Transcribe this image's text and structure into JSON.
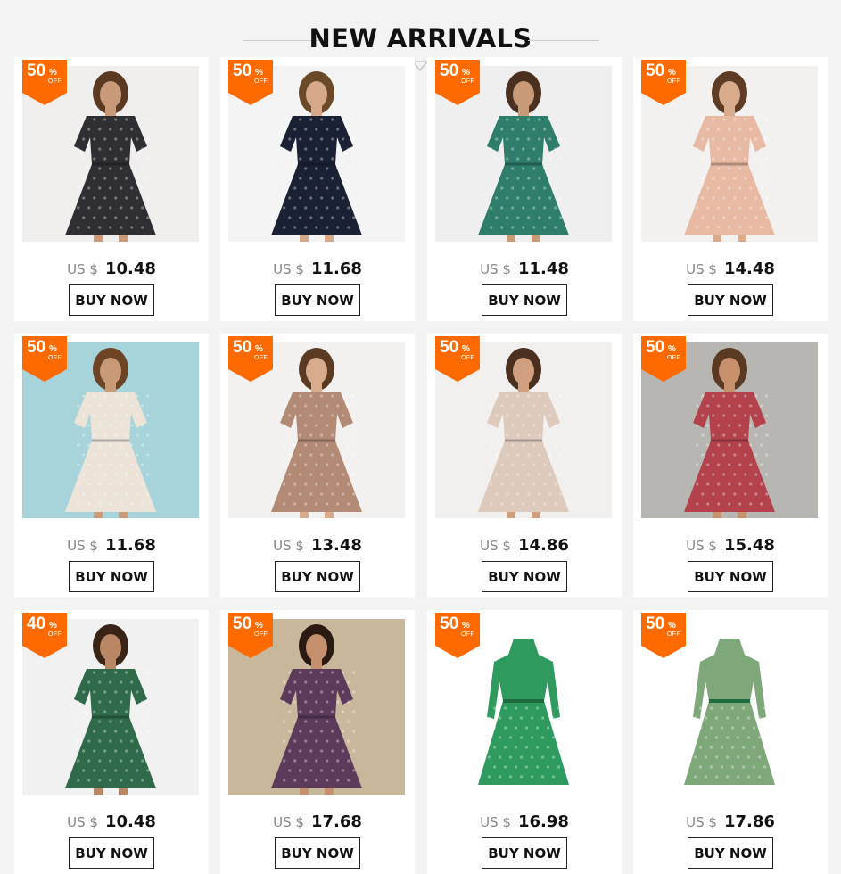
{
  "header": {
    "title": "NEW ARRIVALS",
    "arrow_icon": "chevron-down-icon"
  },
  "badge": {
    "percent_sign": "%",
    "off_label": "OFF",
    "color": "#ff6a00"
  },
  "products": [
    {
      "discount": "50",
      "currency": "US $",
      "price": "10.48",
      "button": "BUY NOW",
      "dress": "#2f2f33",
      "skin": "#c89a7a",
      "bg": "#f1efee",
      "hair": "#5a3a22"
    },
    {
      "discount": "50",
      "currency": "US $",
      "price": "11.68",
      "button": "BUY NOW",
      "dress": "#1b2134",
      "skin": "#d5a98a",
      "bg": "#f4f4f4",
      "hair": "#6b4a2a"
    },
    {
      "discount": "50",
      "currency": "US $",
      "price": "11.48",
      "button": "BUY NOW",
      "dress": "#2f7d6b",
      "skin": "#c99a78",
      "bg": "#efefef",
      "hair": "#4a3020"
    },
    {
      "discount": "50",
      "currency": "US $",
      "price": "14.48",
      "button": "BUY NOW",
      "dress": "#e8b9a3",
      "skin": "#d8ab8c",
      "bg": "#f2f1ef",
      "hair": "#5d3b25"
    },
    {
      "discount": "50",
      "currency": "US $",
      "price": "11.68",
      "button": "BUY NOW",
      "dress": "#ece3d9",
      "skin": "#c99a78",
      "bg": "#a7d3db",
      "hair": "#6d4526"
    },
    {
      "discount": "50",
      "currency": "US $",
      "price": "13.48",
      "button": "BUY NOW",
      "dress": "#b38a76",
      "skin": "#d7ab8c",
      "bg": "#f3f1ef",
      "hair": "#5a3a22"
    },
    {
      "discount": "50",
      "currency": "US $",
      "price": "14.86",
      "button": "BUY NOW",
      "dress": "#ddcabc",
      "skin": "#cf9f80",
      "bg": "#f2f0ee",
      "hair": "#4b3020"
    },
    {
      "discount": "50",
      "currency": "US $",
      "price": "15.48",
      "button": "BUY NOW",
      "dress": "#b3424d",
      "skin": "#c8916e",
      "bg": "#b8b6b3",
      "hair": "#5a3a22"
    },
    {
      "discount": "40",
      "currency": "US $",
      "price": "10.48",
      "button": "BUY NOW",
      "dress": "#2f6a4a",
      "skin": "#b98766",
      "bg": "#f1f1f1",
      "hair": "#3a2418"
    },
    {
      "discount": "50",
      "currency": "US $",
      "price": "17.68",
      "button": "BUY NOW",
      "dress": "#5c3a5a",
      "skin": "#c4906e",
      "bg": "#c9b79b",
      "hair": "#2a1a12"
    },
    {
      "discount": "50",
      "currency": "US $",
      "price": "16.98",
      "button": "BUY NOW",
      "dress": "#2f9a5e",
      "skin": "",
      "bg": "#ffffff",
      "hair": ""
    },
    {
      "discount": "50",
      "currency": "US $",
      "price": "17.86",
      "button": "BUY NOW",
      "dress": "#7fa87a",
      "skin": "",
      "bg": "#ffffff",
      "hair": ""
    }
  ]
}
